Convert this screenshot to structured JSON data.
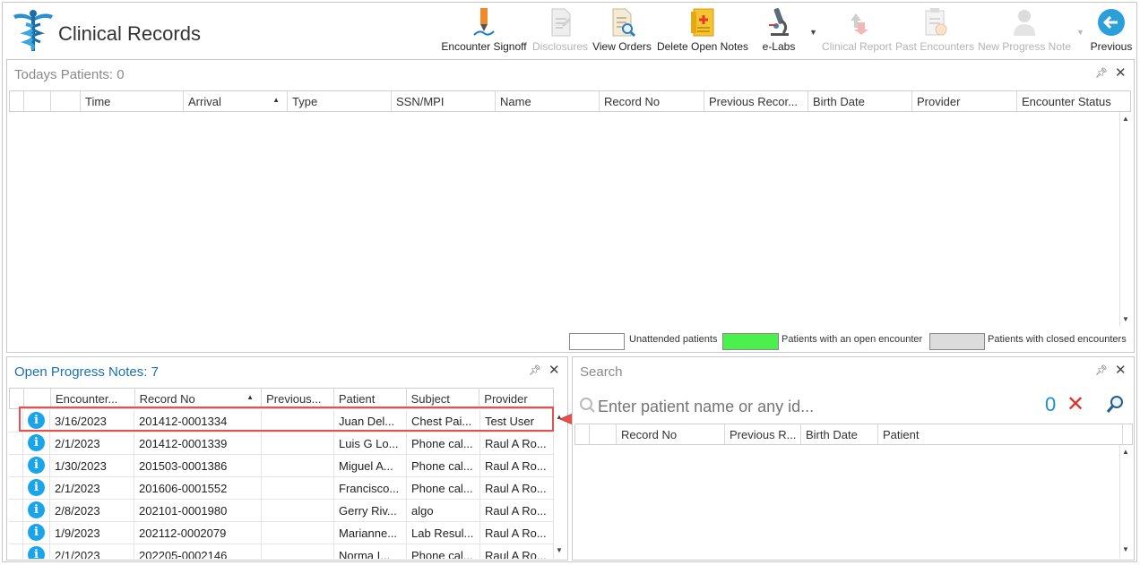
{
  "app": {
    "title": "Clinical Records"
  },
  "toolbar": {
    "items": [
      {
        "label": "Encounter Signoff",
        "icon": "pen-signoff-icon",
        "enabled": true
      },
      {
        "label": "Disclosures",
        "icon": "document-disclosures-icon",
        "enabled": false
      },
      {
        "label": "View Orders",
        "icon": "document-search-icon",
        "enabled": true
      },
      {
        "label": "Delete Open Notes",
        "icon": "notes-delete-icon",
        "enabled": true
      },
      {
        "label": "e-Labs",
        "icon": "microscope-icon",
        "enabled": true,
        "has_dropdown": true
      },
      {
        "label": "Clinical Report",
        "icon": "report-arrows-icon",
        "enabled": false
      },
      {
        "label": "Past Encounters",
        "icon": "clipboard-clock-icon",
        "enabled": false
      },
      {
        "label": "New Progress Note",
        "icon": "user-add-icon",
        "enabled": false,
        "has_dropdown": true
      },
      {
        "label": "Previous",
        "icon": "back-arrow-icon",
        "enabled": true
      }
    ]
  },
  "todays_patients": {
    "title": "Todays Patients:",
    "count": "0",
    "columns": [
      "Time",
      "Arrival",
      "Type",
      "SSN/MPI",
      "Name",
      "Record No",
      "Previous Recor...",
      "Birth Date",
      "Provider",
      "Encounter Status"
    ],
    "sorted_column": "Arrival"
  },
  "legend": {
    "unattended": "Unattended patients",
    "open": "Patients with an open encounter",
    "closed": "Patients with closed encounters",
    "colors": {
      "unattended": "#ffffff",
      "open": "#4cf04c",
      "closed": "#dcdcdc"
    }
  },
  "open_progress_notes": {
    "title": "Open Progress Notes:",
    "count": "7",
    "columns": [
      "Encounter...",
      "Record No",
      "Previous...",
      "Patient",
      "Subject",
      "Provider"
    ],
    "sorted_column": "Record No",
    "rows": [
      {
        "date": "3/16/2023",
        "record": "201412-0001334",
        "previous": "",
        "patient": "Juan Del...",
        "subject": "Chest Pai...",
        "provider": "Test User"
      },
      {
        "date": "2/1/2023",
        "record": "201412-0001339",
        "previous": "",
        "patient": "Luis G Lo...",
        "subject": "Phone cal...",
        "provider": "Raul A Ro..."
      },
      {
        "date": "1/30/2023",
        "record": "201503-0001386",
        "previous": "",
        "patient": "Miguel A...",
        "subject": "Phone cal...",
        "provider": "Raul A Ro..."
      },
      {
        "date": "2/1/2023",
        "record": "201606-0001552",
        "previous": "",
        "patient": "Francisco...",
        "subject": "Phone cal...",
        "provider": "Raul A Ro..."
      },
      {
        "date": "2/8/2023",
        "record": "202101-0001980",
        "previous": "",
        "patient": "Gerry Riv...",
        "subject": "algo",
        "provider": "Raul A Ro..."
      },
      {
        "date": "1/9/2023",
        "record": "202112-0002079",
        "previous": "",
        "patient": "Marianne...",
        "subject": "Lab Resul...",
        "provider": "Raul A Ro..."
      },
      {
        "date": "2/1/2023",
        "record": "202205-0002146",
        "previous": "",
        "patient": "Norma I...",
        "subject": "Phone cal...",
        "provider": "Raul A Ro..."
      }
    ]
  },
  "search": {
    "title": "Search",
    "placeholder": "Enter patient name or any id...",
    "count": "0",
    "columns": [
      "Record No",
      "Previous R...",
      "Birth Date",
      "Patient"
    ]
  },
  "colors": {
    "accent_blue": "#1d6fb3",
    "highlight_red": "#e5514d",
    "info_blue": "#1aa5ea"
  }
}
